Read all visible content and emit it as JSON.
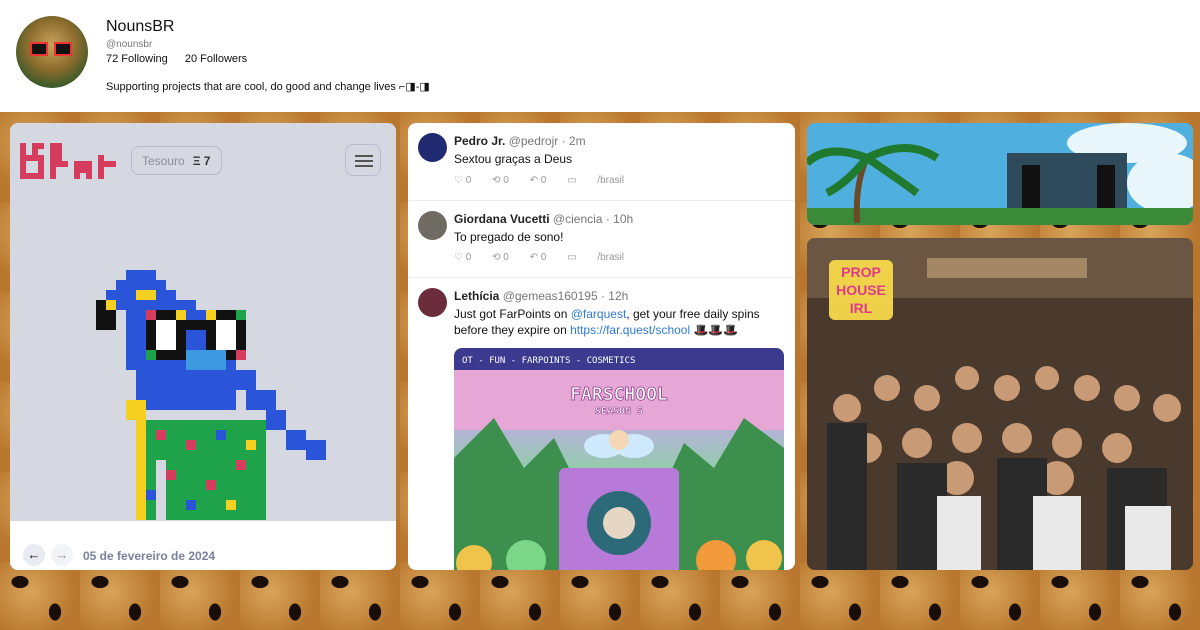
{
  "profile": {
    "name": "NounsBR",
    "handle": "@nounsbr",
    "following": "72 Following",
    "followers": "20 Followers",
    "bio": "Supporting projects that are cool, do good and change lives ⌐◨-◨"
  },
  "nouns_panel": {
    "treasury_label": "Tesouro",
    "treasury_value": "Ξ 7",
    "prev_arrow": "←",
    "next_arrow": "→",
    "date": "05 de fevereiro de 2024"
  },
  "feed": [
    {
      "author": "Pedro Jr.",
      "handle": "@pedrojr",
      "time": "· 2m",
      "text": "Sextou graças a Deus",
      "likes": "♡ 0",
      "recasts": "⟲ 0",
      "replies": "↶ 0",
      "channel": "/brasil",
      "avatar_color": "#1f2a70"
    },
    {
      "author": "Giordana Vucetti",
      "handle": "@ciencia",
      "time": "· 10h",
      "text": "To pregado de sono!",
      "likes": "♡ 0",
      "recasts": "⟲ 0",
      "replies": "↶ 0",
      "channel": "/brasil",
      "avatar_color": "#6f6b62"
    },
    {
      "author": "Lethícia",
      "handle": "@gemeas160195",
      "time": "· 12h",
      "text_before": "Just got FarPoints on ",
      "mention": "@farquest",
      "text_mid": ", get your free daily spins before they expire on ",
      "link": "https://far.quest/school",
      "text_after": " 🎩🎩🎩",
      "avatar_color": "#6b2c3b"
    }
  ],
  "farschool_image": {
    "banner": "OT - FUN - FARPOINTS - COSMETICS",
    "title": "FARSCHOOL",
    "subtitle": "SEASON 5"
  },
  "photo_panel": {
    "sign_line1": "PROP",
    "sign_line2": "HOUSE",
    "sign_line3": "IRL"
  },
  "colors": {
    "nouns_bg": "#d5d7e1",
    "logo_red": "#d63c5e",
    "link_blue": "#2f7ad6"
  }
}
